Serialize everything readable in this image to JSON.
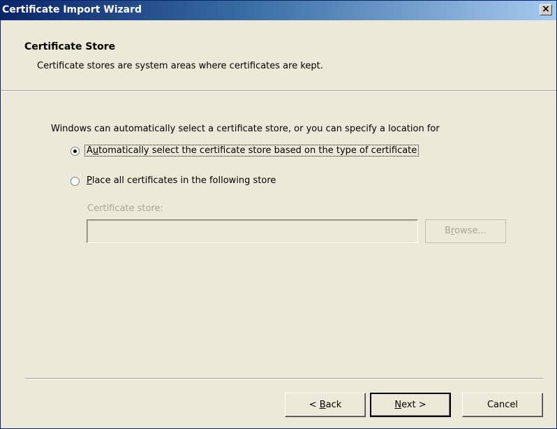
{
  "window": {
    "title": "Certificate Import Wizard",
    "close_glyph": "×"
  },
  "header": {
    "title": "Certificate Store",
    "subtitle": "Certificate stores are system areas where certificates are kept."
  },
  "content": {
    "intro": "Windows can automatically select a certificate store, or you can specify a location for",
    "options": [
      {
        "pre": "A",
        "key": "u",
        "post": "tomatically select the certificate store based on the type of certificate",
        "selected": true
      },
      {
        "pre": "",
        "key": "P",
        "post": "lace all certificates in the following store",
        "selected": false
      }
    ],
    "store_label": "Certificate store:",
    "store_value": "",
    "browse": {
      "pre": "B",
      "key": "r",
      "post": "owse..."
    }
  },
  "footer": {
    "back": {
      "pre": "< ",
      "key": "B",
      "post": "ack"
    },
    "next": {
      "pre": "",
      "key": "N",
      "post": "ext >"
    },
    "cancel": "Cancel"
  }
}
